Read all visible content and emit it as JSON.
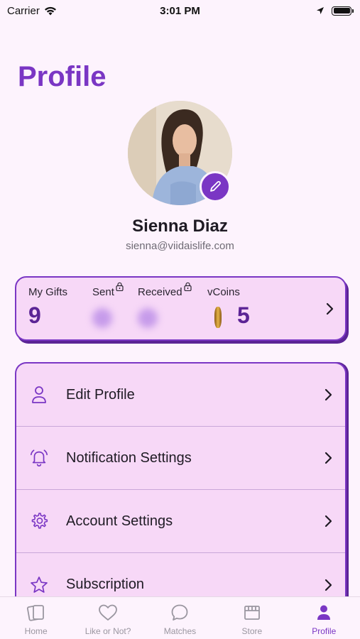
{
  "status_bar": {
    "carrier": "Carrier",
    "time": "3:01 PM"
  },
  "page": {
    "title": "Profile"
  },
  "user": {
    "name": "Sienna Diaz",
    "email": "sienna@viidaislife.com"
  },
  "stats": {
    "my_gifts": {
      "label": "My Gifts",
      "value": "9"
    },
    "sent": {
      "label": "Sent"
    },
    "received": {
      "label": "Received"
    },
    "vcoins": {
      "label": "vCoins",
      "value": "5"
    }
  },
  "menu": {
    "items": [
      {
        "label": "Edit Profile",
        "icon": "person-icon"
      },
      {
        "label": "Notification Settings",
        "icon": "bell-icon"
      },
      {
        "label": "Account Settings",
        "icon": "gear-icon"
      },
      {
        "label": "Subscription",
        "icon": "star-icon"
      }
    ]
  },
  "tabs": [
    {
      "label": "Home",
      "icon": "cards-icon"
    },
    {
      "label": "Like or Not?",
      "icon": "heart-icon"
    },
    {
      "label": "Matches",
      "icon": "chat-bubble-icon"
    },
    {
      "label": "Store",
      "icon": "store-icon"
    },
    {
      "label": "Profile",
      "icon": "person-icon",
      "active": true
    }
  ],
  "colors": {
    "accent": "#7a36c4",
    "card": "#f7d8f7",
    "background": "#fdf3fd"
  }
}
